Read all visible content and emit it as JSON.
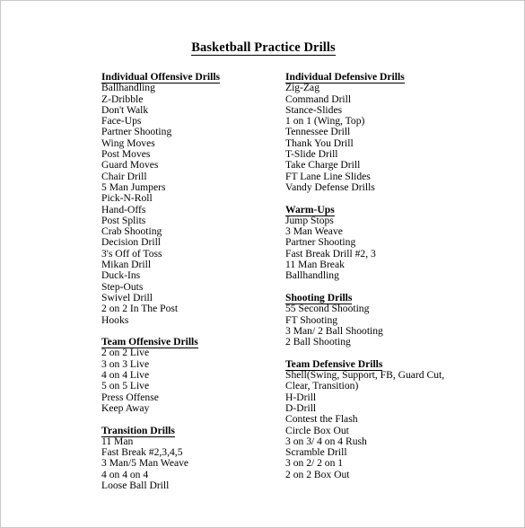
{
  "document": {
    "title": "Basketball Practice Drills",
    "columns": {
      "left": [
        {
          "heading": "Individual Offensive Drills",
          "items": [
            "Ballhandling",
            "Z-Dribble",
            "Don't Walk",
            "Face-Ups",
            "Partner Shooting",
            "Wing Moves",
            "Post Moves",
            "Guard Moves",
            "Chair Drill",
            "5 Man Jumpers",
            "Pick-N-Roll",
            "Hand-Offs",
            "Post Splits",
            "Crab Shooting",
            "Decision Drill",
            "3's Off of Toss",
            "Mikan Drill",
            "Duck-Ins",
            "Step-Outs",
            "Swivel Drill",
            "2 on 2 In The Post",
            "Hooks"
          ]
        },
        {
          "heading": "Team Offensive Drills",
          "items": [
            "2 on 2 Live",
            "3 on 3 Live",
            "4 on 4 Live",
            "5 on 5 Live",
            "Press Offense",
            "Keep Away"
          ]
        },
        {
          "heading": "Transition Drills",
          "items": [
            "11 Man",
            "Fast Break #2,3,4,5",
            "3 Man/5 Man Weave",
            "4 on 4 on 4",
            "Loose Ball Drill"
          ]
        }
      ],
      "right": [
        {
          "heading": "Individual Defensive Drills",
          "items": [
            "Zig-Zag",
            "Command Drill",
            "Stance-Slides",
            "1 on 1 (Wing, Top)",
            "Tennessee Drill",
            "Thank You Drill",
            "T-Slide Drill",
            "Take Charge Drill",
            "FT Lane Line Slides",
            "Vandy Defense Drills"
          ]
        },
        {
          "heading": "Warm-Ups",
          "items": [
            "Jump Stops",
            "3 Man Weave",
            "Partner Shooting",
            "Fast Break Drill #2, 3",
            "11 Man Break",
            "Ballhandling"
          ]
        },
        {
          "heading": "Shooting Drills",
          "items": [
            "55 Second Shooting",
            "FT Shooting",
            "3 Man/ 2 Ball Shooting",
            "2 Ball Shooting"
          ]
        },
        {
          "heading": "Team Defensive Drills",
          "items": [
            "Shell(Swing, Support, FB, Guard Cut, Clear, Transition)",
            "H-Drill",
            "D-Drill",
            "Contest the Flash",
            "Circle Box Out",
            "3 on 3/ 4 on 4 Rush",
            "Scramble Drill",
            "3 on 2/ 2 on 1",
            "2 on 2 Box Out"
          ]
        }
      ]
    }
  }
}
